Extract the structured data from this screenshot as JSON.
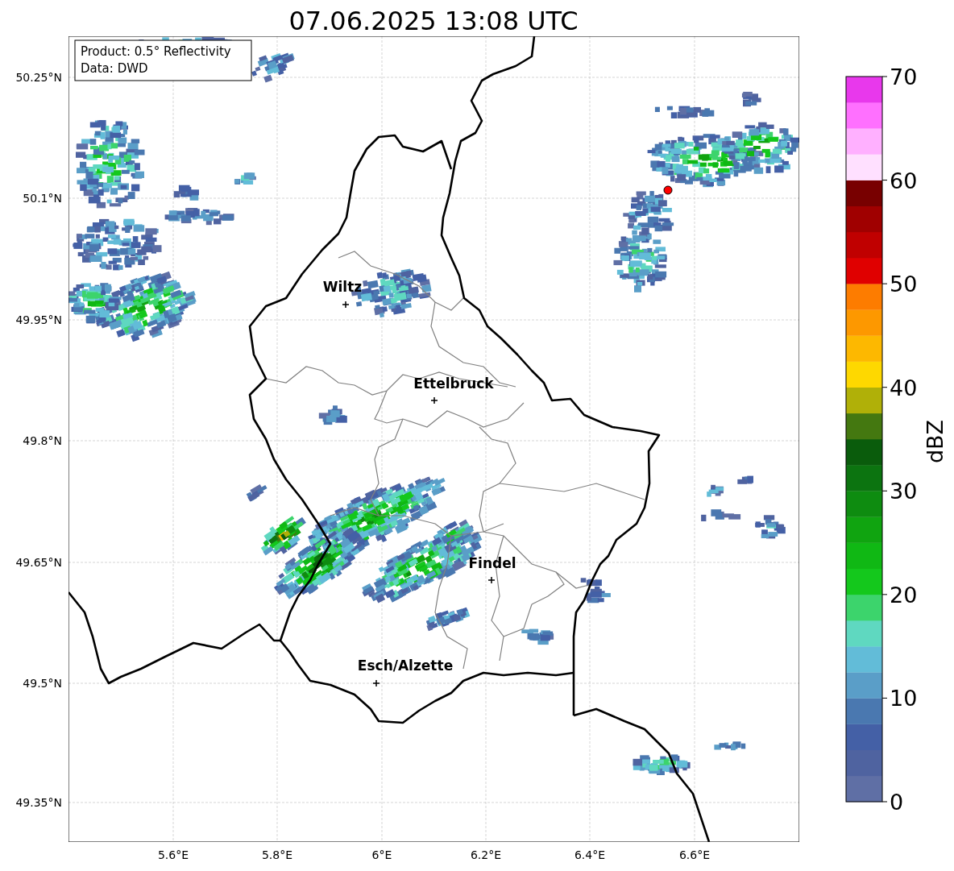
{
  "title": "07.06.2025 13:08 UTC",
  "info_box": {
    "lines": [
      "Product: 0.5° Reflectivity",
      "Data: DWD"
    ]
  },
  "map": {
    "x_ticks": [
      "5.6°E",
      "5.8°E",
      "6°E",
      "6.2°E",
      "6.4°E",
      "6.6°E"
    ],
    "y_ticks": [
      "50.25°N",
      "50.1°N",
      "49.95°N",
      "49.8°N",
      "49.65°N",
      "49.5°N",
      "49.35°N"
    ],
    "cities": [
      {
        "name": "Wiltz"
      },
      {
        "name": "Ettelbruck"
      },
      {
        "name": "Findel"
      },
      {
        "name": "Esch/Alzette"
      }
    ]
  },
  "colorbar": {
    "label": "dBZ",
    "ticks": [
      "70",
      "60",
      "50",
      "40",
      "30",
      "20",
      "10",
      "0"
    ],
    "bins": [
      {
        "color": "#5f6fa5"
      },
      {
        "color": "#4f63a0"
      },
      {
        "color": "#4460a6"
      },
      {
        "color": "#4a78b0"
      },
      {
        "color": "#5a9ec8"
      },
      {
        "color": "#62bcd8"
      },
      {
        "color": "#5fd8c0"
      },
      {
        "color": "#3cd46c"
      },
      {
        "color": "#14c81c"
      },
      {
        "color": "#10b814"
      },
      {
        "color": "#10a410"
      },
      {
        "color": "#0e8c10"
      },
      {
        "color": "#0c7410"
      },
      {
        "color": "#0a5c0c"
      },
      {
        "color": "#447810"
      },
      {
        "color": "#b0b008"
      },
      {
        "color": "#fed800"
      },
      {
        "color": "#fdb800"
      },
      {
        "color": "#fd9800"
      },
      {
        "color": "#fd7c00"
      },
      {
        "color": "#e00000"
      },
      {
        "color": "#c00000"
      },
      {
        "color": "#a00000"
      },
      {
        "color": "#780000"
      },
      {
        "color": "#ffe0ff"
      },
      {
        "color": "#ffb0ff"
      },
      {
        "color": "#ff70ff"
      },
      {
        "color": "#e838ec"
      }
    ]
  }
}
